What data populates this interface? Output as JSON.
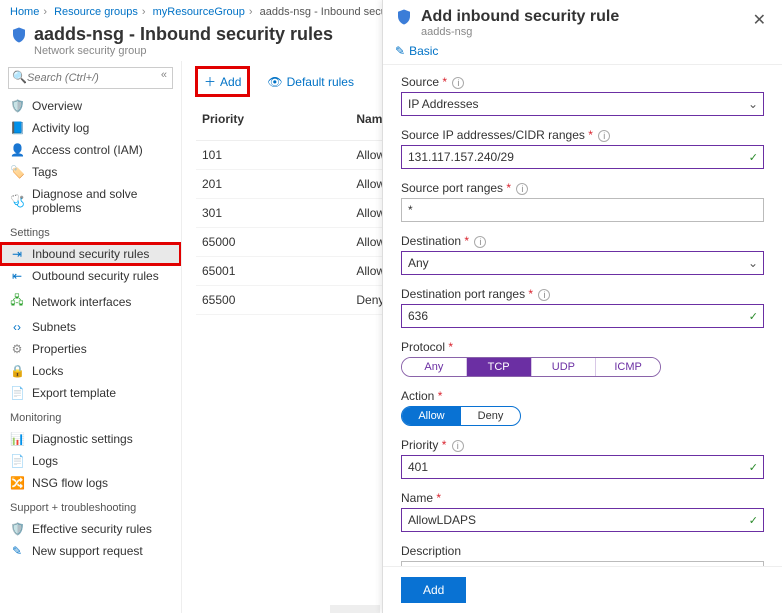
{
  "breadcrumbs": [
    "Home",
    "Resource groups",
    "myResourceGroup",
    "aadds-nsg - Inbound security rules"
  ],
  "header": {
    "title": "aadds-nsg - Inbound security rules",
    "subtitle": "Network security group"
  },
  "search": {
    "placeholder": "Search (Ctrl+/)"
  },
  "sidebar": {
    "top": [
      {
        "icon": "🛡️",
        "label": "Overview"
      },
      {
        "icon": "📘",
        "label": "Activity log"
      },
      {
        "icon": "👤",
        "label": "Access control (IAM)"
      },
      {
        "icon": "🏷️",
        "label": "Tags"
      },
      {
        "icon": "🩺",
        "label": "Diagnose and solve problems"
      }
    ],
    "groups": [
      {
        "heading": "Settings",
        "items": [
          {
            "icon": "⇥",
            "label": "Inbound security rules",
            "active": true
          },
          {
            "icon": "⇤",
            "label": "Outbound security rules"
          },
          {
            "icon": "🖧",
            "label": "Network interfaces",
            "cls": "green"
          },
          {
            "icon": "‹›",
            "label": "Subnets"
          },
          {
            "icon": "⚙",
            "label": "Properties",
            "cls": "gray"
          },
          {
            "icon": "🔒",
            "label": "Locks"
          },
          {
            "icon": "📄",
            "label": "Export template"
          }
        ]
      },
      {
        "heading": "Monitoring",
        "items": [
          {
            "icon": "📊",
            "label": "Diagnostic settings",
            "cls": "teal"
          },
          {
            "icon": "📄",
            "label": "Logs"
          },
          {
            "icon": "🔀",
            "label": "NSG flow logs",
            "cls": "orange"
          }
        ]
      },
      {
        "heading": "Support + troubleshooting",
        "items": [
          {
            "icon": "🛡️",
            "label": "Effective security rules"
          },
          {
            "icon": "✎",
            "label": "New support request"
          }
        ]
      }
    ]
  },
  "toolbar": {
    "add": "Add",
    "default": "Default rules"
  },
  "table": {
    "headers": [
      "Priority",
      "Name"
    ],
    "rows": [
      {
        "priority": "101",
        "name": "AllowSyncWithAzureAD"
      },
      {
        "priority": "201",
        "name": "AllowRD"
      },
      {
        "priority": "301",
        "name": "AllowPSRemoting"
      },
      {
        "priority": "65000",
        "name": "AllowVnetInBound"
      },
      {
        "priority": "65001",
        "name": "AllowAzureLoadBalancer"
      },
      {
        "priority": "65500",
        "name": "DenyAllInBound"
      }
    ]
  },
  "blade": {
    "title": "Add inbound security rule",
    "subtitle": "aadds-nsg",
    "tab_basic": "Basic",
    "fields": {
      "source_label": "Source",
      "source_value": "IP Addresses",
      "sourceip_label": "Source IP addresses/CIDR ranges",
      "sourceip_value": "131.117.157.240/29",
      "sourceport_label": "Source port ranges",
      "sourceport_value": "*",
      "dest_label": "Destination",
      "dest_value": "Any",
      "destport_label": "Destination port ranges",
      "destport_value": "636",
      "protocol_label": "Protocol",
      "protocol_options": [
        "Any",
        "TCP",
        "UDP",
        "ICMP"
      ],
      "protocol_selected": "TCP",
      "action_label": "Action",
      "action_options": [
        "Allow",
        "Deny"
      ],
      "action_selected": "Allow",
      "priority_label": "Priority",
      "priority_value": "401",
      "name_label": "Name",
      "name_value": "AllowLDAPS",
      "description_label": "Description"
    },
    "submit": "Add"
  }
}
